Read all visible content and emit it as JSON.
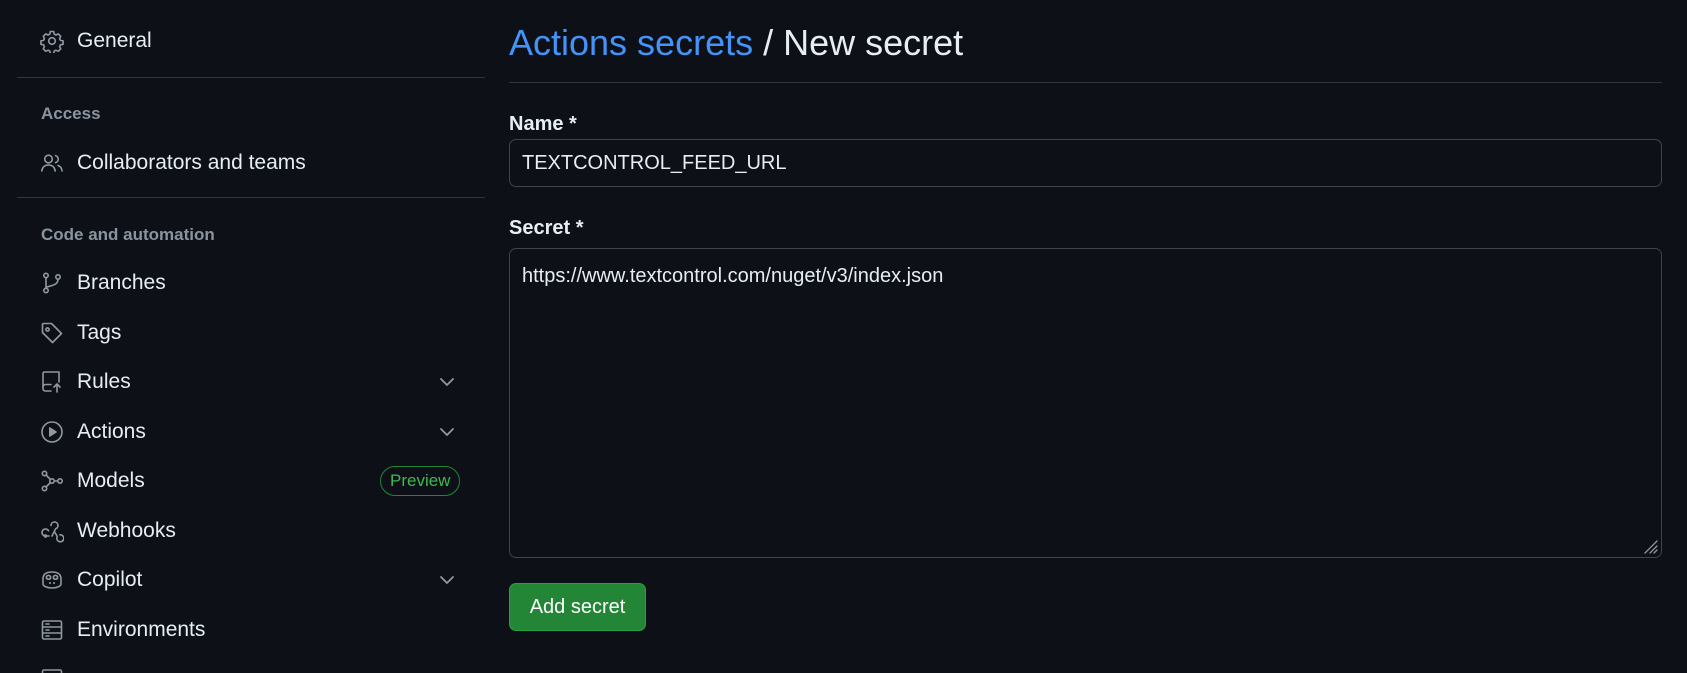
{
  "sidebar": {
    "items": [
      {
        "label": "General",
        "icon": "gear-icon"
      },
      {
        "label": "Collaborators and teams",
        "icon": "people-icon"
      },
      {
        "label": "Branches",
        "icon": "git-branch-icon"
      },
      {
        "label": "Tags",
        "icon": "tag-icon"
      },
      {
        "label": "Rules",
        "icon": "repo-push-icon",
        "expandable": true
      },
      {
        "label": "Actions",
        "icon": "play-icon",
        "expandable": true
      },
      {
        "label": "Models",
        "icon": "ai-model-icon",
        "badge": "Preview"
      },
      {
        "label": "Webhooks",
        "icon": "webhook-icon"
      },
      {
        "label": "Copilot",
        "icon": "copilot-icon",
        "expandable": true
      },
      {
        "label": "Environments",
        "icon": "server-icon"
      },
      {
        "label": "",
        "icon": "table-icon"
      }
    ],
    "sections": {
      "access": "Access",
      "code_automation": "Code and automation"
    }
  },
  "header": {
    "breadcrumb_link": "Actions secrets",
    "separator": " / ",
    "title": "New secret"
  },
  "form": {
    "name_label": "Name *",
    "name_value": "TEXTCONTROL_FEED_URL",
    "secret_label": "Secret *",
    "secret_value": "https://www.textcontrol.com/nuget/v3/index.json",
    "submit_label": "Add secret"
  },
  "colors": {
    "background": "#0d1117",
    "link": "#4493f8",
    "primary_button": "#238636",
    "badge": "#3fb950",
    "border": "#30363d"
  }
}
